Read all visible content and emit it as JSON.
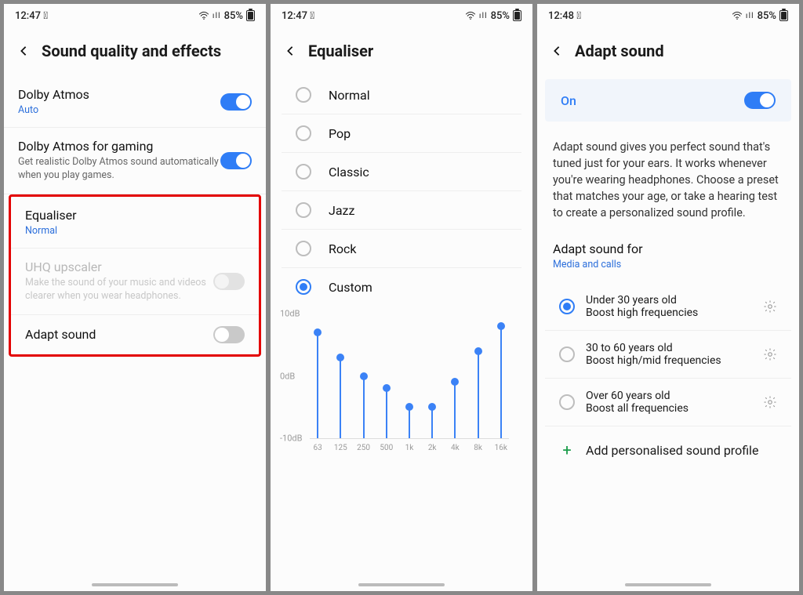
{
  "status": {
    "time_a": "12:47",
    "time_b": "12:47",
    "time_c": "12:48",
    "battery": "85%"
  },
  "screen1": {
    "title": "Sound quality and effects",
    "items": {
      "dolby": {
        "label": "Dolby Atmos",
        "sub": "Auto",
        "on": true
      },
      "dolby_gaming": {
        "label": "Dolby Atmos for gaming",
        "sub": "Get realistic Dolby Atmos sound automatically when you play games.",
        "on": true
      },
      "equaliser": {
        "label": "Equaliser",
        "sub": "Normal"
      },
      "uhq": {
        "label": "UHQ upscaler",
        "sub": "Make the sound of your music and videos clearer when you wear headphones.",
        "on": false,
        "disabled": true
      },
      "adapt": {
        "label": "Adapt sound",
        "on": false
      }
    }
  },
  "screen2": {
    "title": "Equaliser",
    "options": [
      "Normal",
      "Pop",
      "Classic",
      "Jazz",
      "Rock",
      "Custom"
    ],
    "selected": "Custom"
  },
  "chart_data": {
    "type": "bar",
    "title": "",
    "xlabel": "",
    "ylabel": "",
    "ylim": [
      -10,
      10
    ],
    "ytick_labels": [
      "10dB",
      "0dB",
      "-10dB"
    ],
    "categories": [
      "63",
      "125",
      "250",
      "500",
      "1k",
      "2k",
      "4k",
      "8k",
      "16k"
    ],
    "values": [
      7,
      3,
      0,
      -2,
      -5,
      -5,
      -1,
      4,
      8
    ]
  },
  "screen3": {
    "title": "Adapt sound",
    "on_label": "On",
    "on": true,
    "description": "Adapt sound gives you perfect sound that's tuned just for your ears. It works whenever you're wearing headphones. Choose a preset that matches your age, or take a hearing test to create a personalized sound profile.",
    "adapt_for": {
      "label": "Adapt sound for",
      "sub": "Media and calls"
    },
    "age_options": [
      {
        "label": "Under 30 years old",
        "sub": "Boost high frequencies",
        "selected": true
      },
      {
        "label": "30 to 60 years old",
        "sub": "Boost high/mid frequencies",
        "selected": false
      },
      {
        "label": "Over 60 years old",
        "sub": "Boost all frequencies",
        "selected": false
      }
    ],
    "add_label": "Add personalised sound profile"
  }
}
